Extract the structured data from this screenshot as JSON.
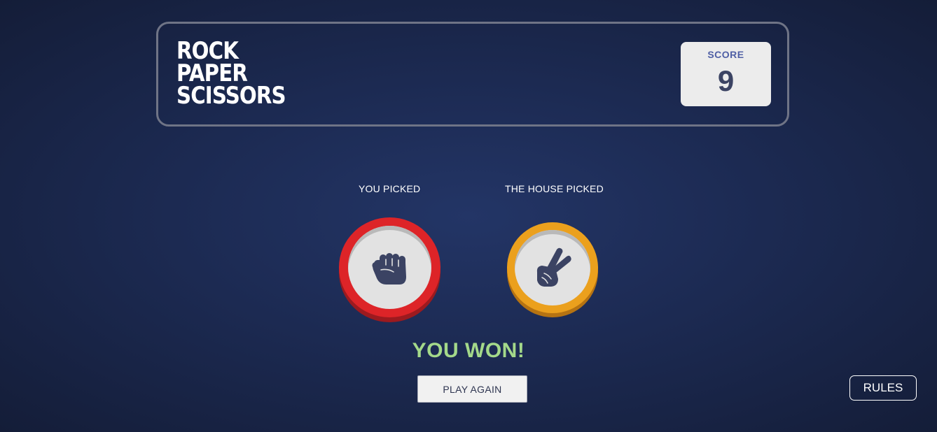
{
  "header": {
    "title_lines": [
      "ROCK",
      "PAPER",
      "SCISSORS"
    ],
    "score_label": "SCORE",
    "score_value": "9"
  },
  "game": {
    "user_label": "YOU PICKED",
    "house_label": "THE HOUSE PICKED",
    "user_pick": {
      "choice": "rock",
      "icon": "rock-fist-icon",
      "ring_color": "#dd2428"
    },
    "house_pick": {
      "choice": "scissors",
      "icon": "scissors-hand-icon",
      "ring_color": "#eba01d"
    },
    "result": "YOU WON!",
    "result_color": "#a4d98a",
    "play_again_label": "PLAY AGAIN"
  },
  "footer": {
    "rules_label": "RULES"
  }
}
